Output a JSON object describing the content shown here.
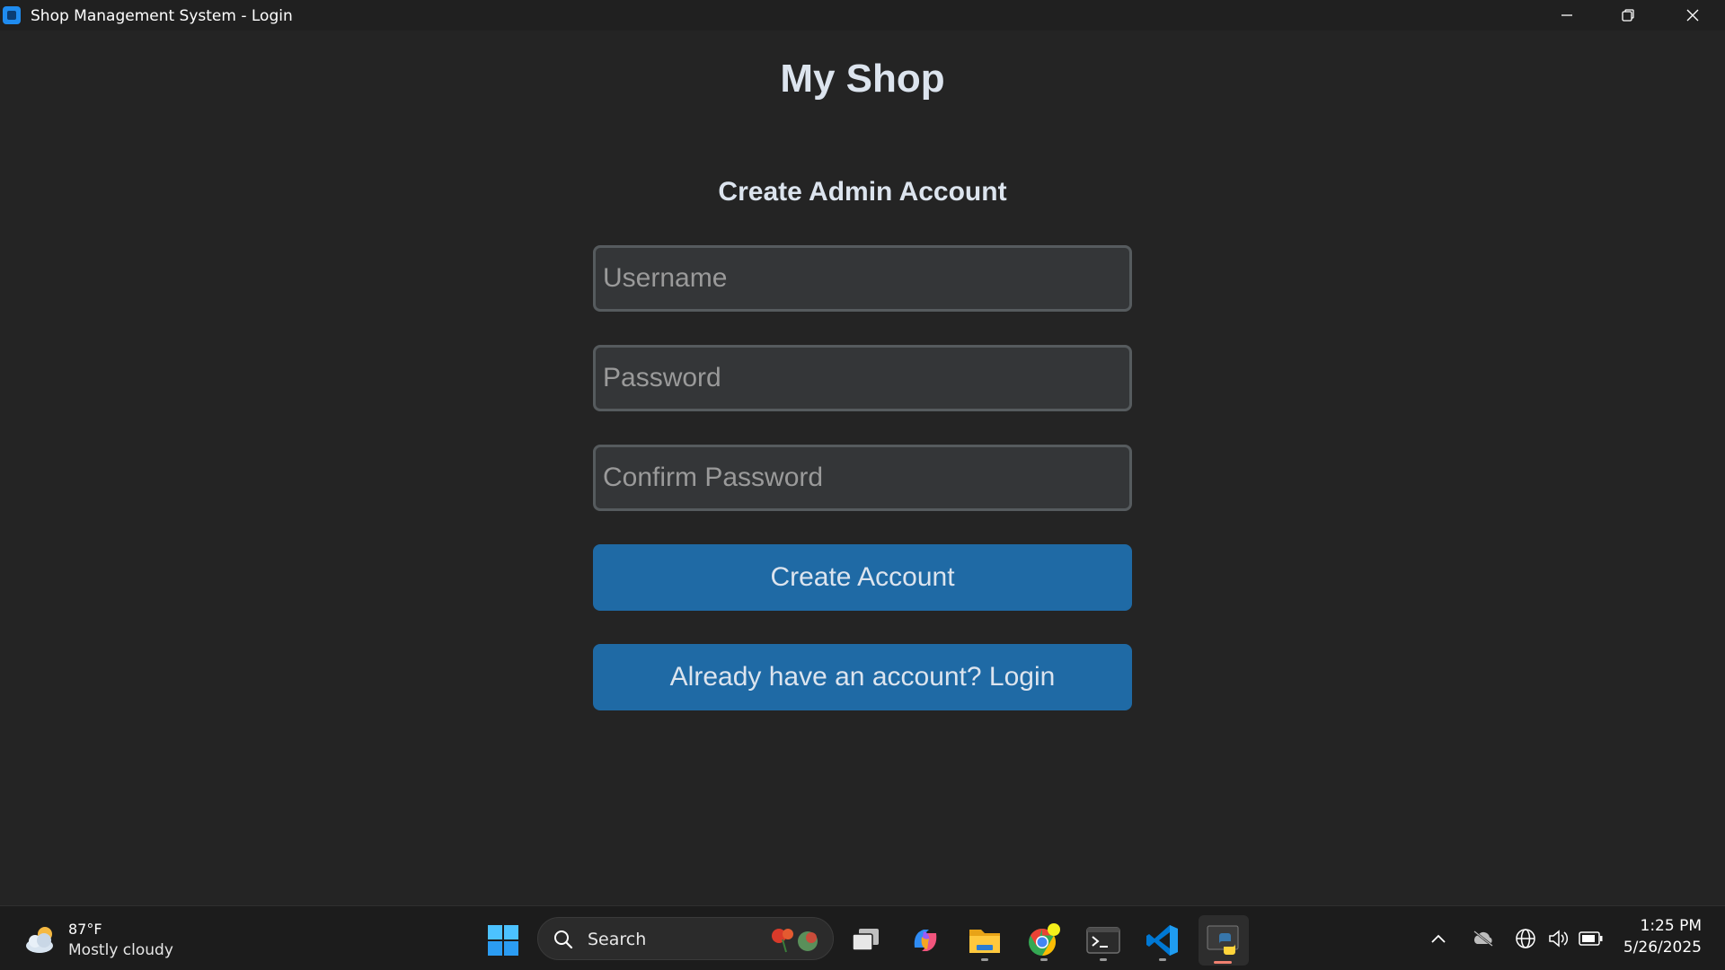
{
  "window": {
    "title": "Shop Management System - Login"
  },
  "main": {
    "shop_title": "My Shop",
    "form_title": "Create Admin Account",
    "username_placeholder": "Username",
    "password_placeholder": "Password",
    "confirm_placeholder": "Confirm Password",
    "create_button": "Create Account",
    "login_button": "Already have an account? Login"
  },
  "taskbar": {
    "weather_temp": "87°F",
    "weather_desc": "Mostly cloudy",
    "search_label": "Search",
    "time": "1:25 PM",
    "date": "5/26/2025",
    "apps": [
      "start-icon",
      "task-view-icon",
      "copilot-icon",
      "file-explorer-icon",
      "chrome-icon",
      "terminal-icon",
      "vscode-icon",
      "python-app-icon"
    ]
  },
  "colors": {
    "background": "#242424",
    "field_bg": "#343638",
    "field_border": "#565b5e",
    "button_bg": "#1f6aa5",
    "text": "#dce4ee"
  }
}
